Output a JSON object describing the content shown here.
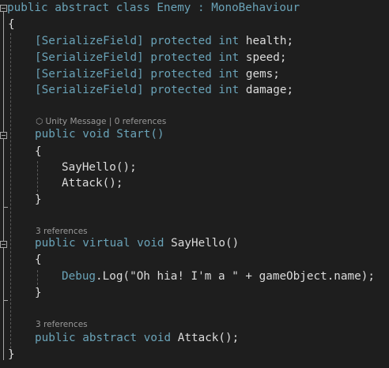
{
  "code": {
    "class_decl": {
      "kw": "public abstract class ",
      "name": "Enemy",
      "sep": " : ",
      "base": "MonoBehaviour"
    },
    "open_brace": "{",
    "close_brace": "}",
    "fields": [
      {
        "attr": "[SerializeField]",
        "mods": " protected int ",
        "name": "health;"
      },
      {
        "attr": "[SerializeField]",
        "mods": " protected int ",
        "name": "speed;"
      },
      {
        "attr": "[SerializeField]",
        "mods": " protected int ",
        "name": "gems;"
      },
      {
        "attr": "[SerializeField]",
        "mods": " protected int ",
        "name": "damage;"
      }
    ],
    "start": {
      "lens_unity": "Unity Message",
      "lens_sep": "|",
      "lens_refs": "0 references",
      "decl_kw": "public void ",
      "decl_name": "Start()",
      "body": [
        "SayHello();",
        "Attack();"
      ]
    },
    "sayhello": {
      "lens_refs": "3 references",
      "decl_kw": "public virtual void ",
      "decl_name": "SayHello()",
      "body_cls": "Debug",
      "body_rest": ".Log(\"Oh hia! I'm a \" + gameObject.name);"
    },
    "attack": {
      "lens_refs": "3 references",
      "decl_kw": "public abstract void ",
      "decl_name": "Attack();"
    }
  }
}
